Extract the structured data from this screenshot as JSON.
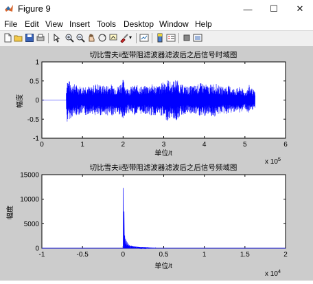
{
  "window": {
    "title": "Figure 9",
    "minimize_glyph": "—",
    "maximize_glyph": "☐",
    "close_glyph": "✕"
  },
  "menu": {
    "file": "File",
    "edit": "Edit",
    "view": "View",
    "insert": "Insert",
    "tools": "Tools",
    "desktop": "Desktop",
    "window": "Window",
    "help": "Help"
  },
  "toolbar_icons": [
    "new-figure-icon",
    "open-file-icon",
    "save-icon",
    "print-icon",
    "edit-plot-icon",
    "zoom-in-icon",
    "zoom-out-icon",
    "pan-icon",
    "rotate-3d-icon",
    "data-cursor-icon",
    "brush-icon",
    "link-plot-icon",
    "insert-colorbar-icon",
    "insert-legend-icon",
    "hide-plot-tools-icon",
    "show-plot-tools-icon"
  ],
  "chart_data": [
    {
      "type": "line",
      "title": "切比雪夫ii型带阻滤波器滤波后之后信号时域图",
      "xlabel": "单位/t",
      "ylabel": "幅度",
      "x_exponent": "x 10",
      "x_exponent_power": "5",
      "xlim": [
        0,
        6
      ],
      "ylim": [
        -1,
        1
      ],
      "xticks": [
        "0",
        "1",
        "2",
        "3",
        "4",
        "5",
        "6"
      ],
      "yticks": [
        "1",
        "0.5",
        "0",
        "-0.5",
        "-1"
      ],
      "line_color": "#0000ff",
      "signal_start": 0.6,
      "signal_end": 5.25,
      "envelope": [
        [
          0.6,
          0.28
        ],
        [
          0.62,
          0.62
        ],
        [
          0.66,
          0.52
        ],
        [
          0.75,
          0.45
        ],
        [
          0.85,
          0.4
        ],
        [
          1.0,
          0.36
        ],
        [
          1.1,
          0.42
        ],
        [
          1.2,
          0.33
        ],
        [
          1.35,
          0.45
        ],
        [
          1.5,
          0.38
        ],
        [
          1.7,
          0.42
        ],
        [
          1.85,
          0.35
        ],
        [
          2.0,
          0.55
        ],
        [
          2.1,
          0.32
        ],
        [
          2.3,
          0.4
        ],
        [
          2.5,
          0.36
        ],
        [
          2.7,
          0.42
        ],
        [
          2.9,
          0.38
        ],
        [
          3.0,
          0.5
        ],
        [
          3.1,
          0.55
        ],
        [
          3.2,
          0.45
        ],
        [
          3.3,
          0.58
        ],
        [
          3.4,
          0.42
        ],
        [
          3.6,
          0.36
        ],
        [
          3.8,
          0.4
        ],
        [
          3.95,
          0.46
        ],
        [
          4.1,
          0.38
        ],
        [
          4.25,
          0.46
        ],
        [
          4.4,
          0.35
        ],
        [
          4.6,
          0.38
        ],
        [
          4.75,
          0.3
        ],
        [
          4.9,
          0.35
        ],
        [
          5.0,
          0.22
        ],
        [
          5.1,
          0.4
        ],
        [
          5.2,
          0.28
        ],
        [
          5.25,
          0.2
        ]
      ]
    },
    {
      "type": "line",
      "title": "切比雪夫ii型带阻滤波器滤波后之后信号频域图",
      "xlabel": "单位/t",
      "ylabel": "幅度",
      "x_exponent": "x 10",
      "x_exponent_power": "4",
      "xlim": [
        -1,
        2
      ],
      "ylim": [
        0,
        15000
      ],
      "xticks": [
        "-1",
        "-0.5",
        "0",
        "0.5",
        "1",
        "1.5",
        "2"
      ],
      "yticks": [
        "15000",
        "10000",
        "5000",
        "0"
      ],
      "line_color": "#0000ff",
      "peaks": [
        [
          0.0,
          12300
        ],
        [
          0.012,
          7500
        ],
        [
          0.02,
          2600
        ],
        [
          0.03,
          1900
        ],
        [
          0.04,
          1500
        ],
        [
          0.05,
          1200
        ],
        [
          0.065,
          900
        ],
        [
          0.08,
          700
        ],
        [
          0.1,
          520
        ],
        [
          0.12,
          430
        ],
        [
          0.15,
          300
        ],
        [
          0.2,
          220
        ],
        [
          0.25,
          160
        ],
        [
          0.3,
          120
        ],
        [
          0.4,
          80
        ]
      ]
    }
  ]
}
